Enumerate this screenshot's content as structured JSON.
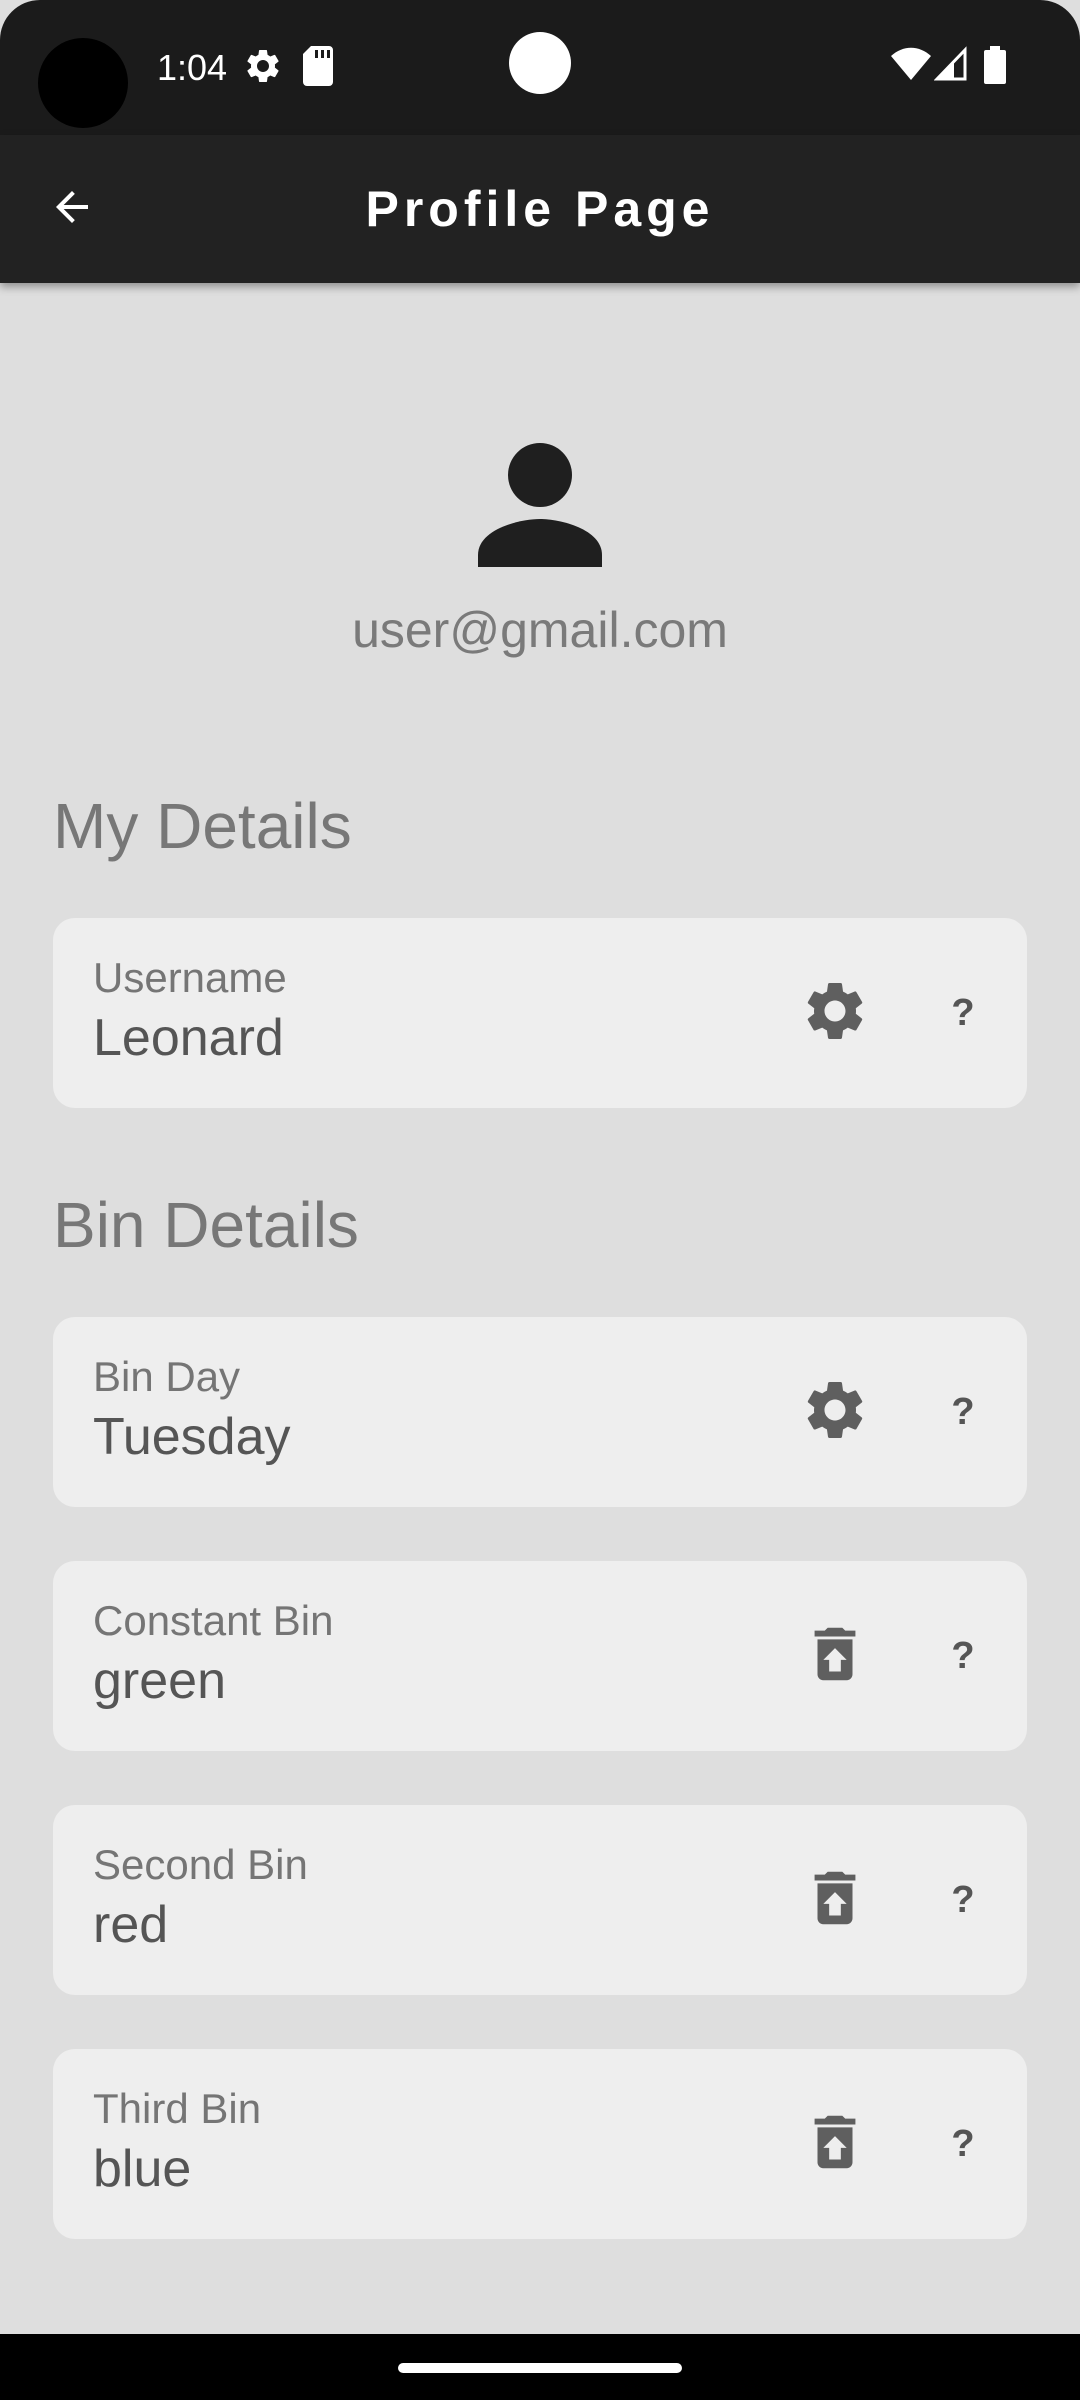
{
  "status_bar": {
    "time": "1:04",
    "icons": [
      "settings-status-icon",
      "sd-card-icon",
      "wifi-icon",
      "signal-icon",
      "battery-icon"
    ]
  },
  "app_bar": {
    "back_icon": "arrow-back-icon",
    "title": "Profile Page"
  },
  "profile": {
    "avatar_icon": "person-icon",
    "email": "user@gmail.com"
  },
  "my_details": {
    "title": "My Details",
    "cards": [
      {
        "label": "Username",
        "value": "Leonard",
        "action_icon": "gear-icon",
        "help": "?"
      }
    ]
  },
  "bin_details": {
    "title": "Bin Details",
    "cards": [
      {
        "label": "Bin Day",
        "value": "Tuesday",
        "action_icon": "gear-icon",
        "help": "?"
      },
      {
        "label": "Constant Bin",
        "value": "green",
        "action_icon": "restore-from-trash-icon",
        "help": "?"
      },
      {
        "label": "Second Bin",
        "value": "red",
        "action_icon": "restore-from-trash-icon",
        "help": "?"
      },
      {
        "label": "Third Bin",
        "value": "blue",
        "action_icon": "restore-from-trash-icon",
        "help": "?"
      }
    ]
  },
  "colors": {
    "app_bar": "#222222",
    "background": "#dedede",
    "card": "#eeeeee",
    "icon": "#5f5f5f"
  }
}
